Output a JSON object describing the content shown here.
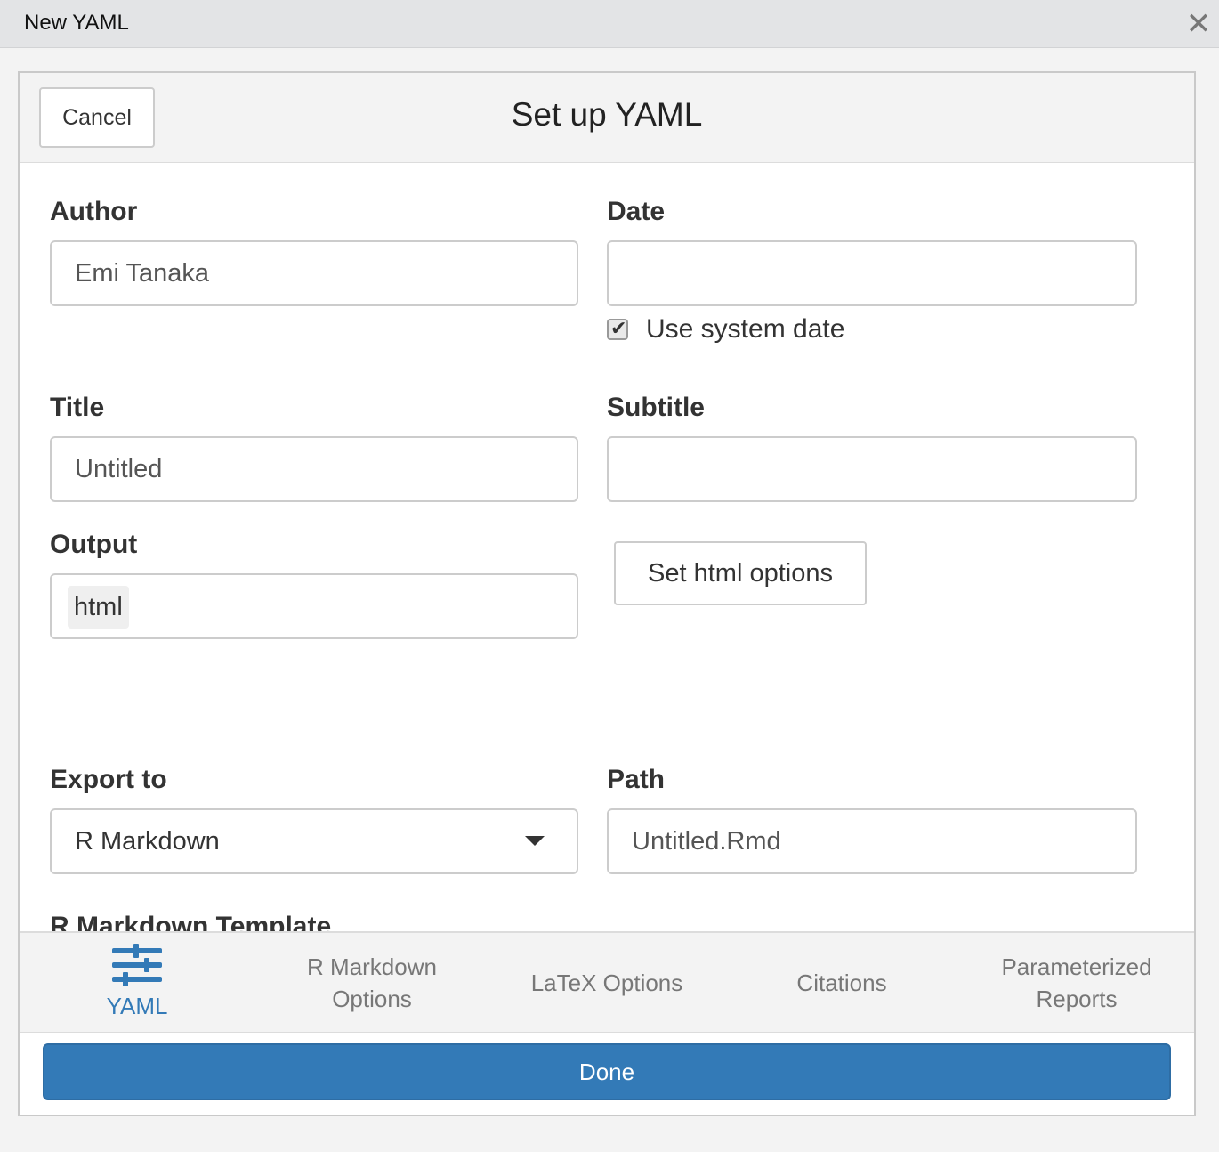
{
  "window": {
    "title": "New YAML",
    "close_glyph": "✕"
  },
  "header": {
    "cancel_label": "Cancel",
    "title": "Set up YAML"
  },
  "form": {
    "author": {
      "label": "Author",
      "value": "Emi Tanaka"
    },
    "date": {
      "label": "Date",
      "value": "",
      "use_system_date_label": "Use system date",
      "use_system_date_checked": true
    },
    "title": {
      "label": "Title",
      "value": "Untitled"
    },
    "subtitle": {
      "label": "Subtitle",
      "value": ""
    },
    "output": {
      "label": "Output",
      "selected": "html",
      "options_button_label": "Set html options"
    },
    "export_to": {
      "label": "Export to",
      "selected": "R Markdown"
    },
    "path": {
      "label": "Path",
      "value": "Untitled.Rmd"
    },
    "template": {
      "label": "R Markdown Template"
    }
  },
  "tabs": [
    {
      "label": "YAML",
      "icon": "sliders-icon",
      "active": true
    },
    {
      "label_line1": "R Markdown",
      "label_line2": "Options"
    },
    {
      "label": "LaTeX Options"
    },
    {
      "label": "Citations"
    },
    {
      "label_line1": "Parameterized",
      "label_line2": "Reports"
    }
  ],
  "footer": {
    "done_label": "Done"
  },
  "colors": {
    "accent": "#337ab7",
    "muted_tab": "#777777"
  }
}
